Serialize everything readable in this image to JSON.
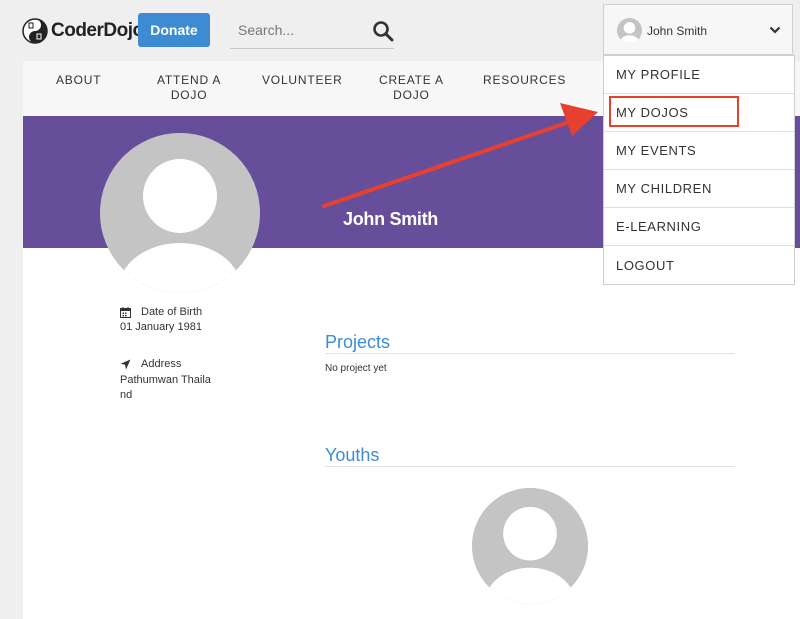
{
  "brand": {
    "name": "CoderDojo"
  },
  "header": {
    "donate_label": "Donate",
    "search_placeholder": "Search..."
  },
  "nav": {
    "about": "ABOUT",
    "attend_l1": "ATTEND A",
    "attend_l2": "DOJO",
    "volunteer": "VOLUNTEER",
    "create_l1": "CREATE A",
    "create_l2": "DOJO",
    "resources": "RESOURCES"
  },
  "profile": {
    "name": "John Smith",
    "dob_label": "Date of Birth",
    "dob_value": "01 January 1981",
    "address_label": "Address",
    "address_line1": "Pathumwan Thaila",
    "address_line2": "nd"
  },
  "sections": {
    "projects_title": "Projects",
    "projects_empty": "No project yet",
    "youths_title": "Youths"
  },
  "user_menu": {
    "user_name": "John Smith",
    "items": [
      "MY PROFILE",
      "MY DOJOS",
      "MY EVENTS",
      "MY CHILDREN",
      "E-LEARNING",
      "LOGOUT"
    ]
  },
  "annotation": {
    "highlight_color": "#e8402f",
    "arrow_color": "#e8402f"
  },
  "colors": {
    "accent": "#3d8cd3",
    "banner": "#674e9a"
  },
  "icons": [
    "search-icon",
    "calendar-icon",
    "location-arrow-icon",
    "chevron-down-icon",
    "avatar-placeholder-icon",
    "yin-yang-logo-icon"
  ]
}
